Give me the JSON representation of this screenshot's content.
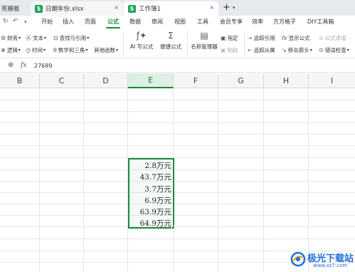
{
  "tabs": [
    {
      "label": "宪模板",
      "icon": "none",
      "active": false
    },
    {
      "label": "日期年份.xlsx",
      "icon": "spreadsheet-icon",
      "active": false
    },
    {
      "label": "工作簿1",
      "icon": "spreadsheet-icon",
      "active": true
    }
  ],
  "tab_badge": "S",
  "menu": {
    "items": [
      "开始",
      "插入",
      "页面",
      "公式",
      "数据",
      "审阅",
      "视图",
      "工具",
      "会员专享",
      "效率",
      "方方格子",
      "DIY工具箱"
    ],
    "active": "公式"
  },
  "ribbon": {
    "row1": {
      "finance": "财务",
      "text": "文本",
      "lookup": "查找与引用",
      "trace_precedents": "追踪引用",
      "show_formulas": "显示公式",
      "formula_guard": "公式求值"
    },
    "row2": {
      "logic": "逻辑",
      "datetime": "时间",
      "math": "数学和三角",
      "other": "其他函数",
      "trace_dependents": "追踪从属",
      "remove_arrows": "移去箭头",
      "error_check": "错误检查"
    },
    "big": {
      "ai_formula": "AI 写公式",
      "quick_formula": "便捷公式",
      "name_manager": "名称管理器",
      "specify": "指定",
      "paste": "粘贴"
    }
  },
  "formula_bar": {
    "fx_label": "fx",
    "value": "27689"
  },
  "columns": [
    "B",
    "C",
    "D",
    "E",
    "F",
    "G",
    "H",
    "I"
  ],
  "selected_column": "E",
  "cells": [
    "2.8万元",
    "43.7万元",
    "3.7万元",
    "6.9万元",
    "63.9万元",
    "64.9万元"
  ],
  "watermark": {
    "text": "极光下载站",
    "url": "www.xz7.com"
  },
  "colors": {
    "accent": "#1a8a3c",
    "selection_header": "#ddeee3",
    "watermark": "#1d6fd6"
  }
}
